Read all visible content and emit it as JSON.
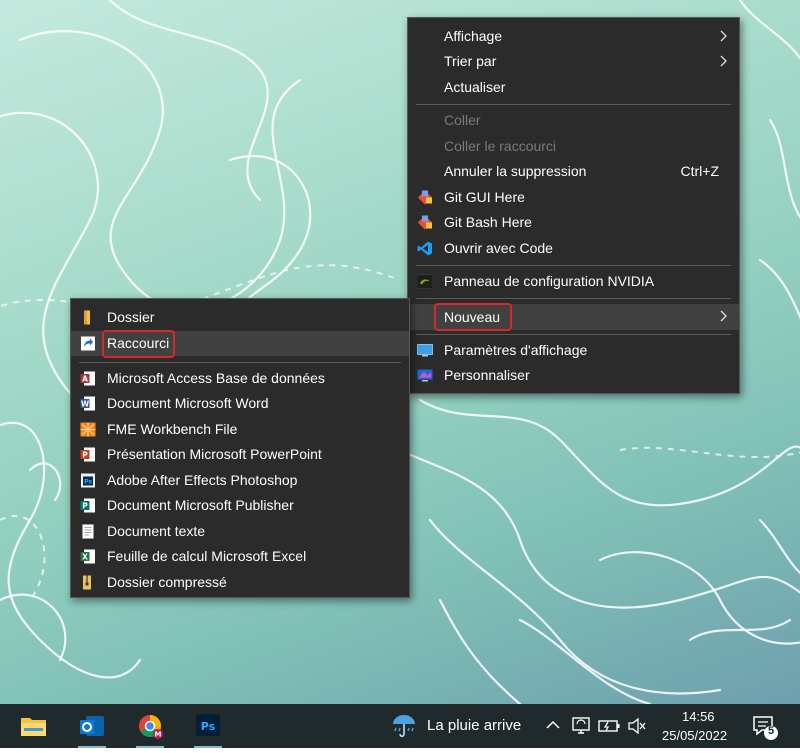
{
  "desktop_menu": {
    "items": [
      {
        "label": "Affichage",
        "submenu": true
      },
      {
        "label": "Trier par",
        "submenu": true
      },
      {
        "label": "Actualiser"
      },
      {
        "label": "Coller",
        "disabled": true
      },
      {
        "label": "Coller le raccourci",
        "disabled": true
      },
      {
        "label": "Annuler la suppression",
        "shortcut": "Ctrl+Z"
      },
      {
        "label": "Git GUI Here",
        "icon": "git-gui-icon"
      },
      {
        "label": "Git Bash Here",
        "icon": "git-bash-icon"
      },
      {
        "label": "Ouvrir avec Code",
        "icon": "vscode-icon"
      },
      {
        "label": "Panneau de configuration NVIDIA",
        "icon": "nvidia-icon"
      },
      {
        "label": "Nouveau",
        "submenu": true,
        "highlighted": true
      },
      {
        "label": "Paramètres d'affichage",
        "icon": "display-settings-icon"
      },
      {
        "label": "Personnaliser",
        "icon": "personalize-icon"
      }
    ]
  },
  "new_submenu": {
    "items": [
      {
        "label": "Dossier",
        "icon": "folder-icon"
      },
      {
        "label": "Raccourci",
        "icon": "shortcut-icon",
        "highlighted": true
      },
      {
        "label": "Microsoft Access Base de données",
        "icon": "access-icon"
      },
      {
        "label": "Document Microsoft Word",
        "icon": "word-icon"
      },
      {
        "label": "FME Workbench File",
        "icon": "fme-icon"
      },
      {
        "label": "Présentation Microsoft PowerPoint",
        "icon": "powerpoint-icon"
      },
      {
        "label": "Adobe After Effects Photoshop",
        "icon": "photoshop-file-icon"
      },
      {
        "label": "Document Microsoft Publisher",
        "icon": "publisher-icon"
      },
      {
        "label": "Document texte",
        "icon": "text-document-icon"
      },
      {
        "label": "Feuille de calcul Microsoft Excel",
        "icon": "excel-icon"
      },
      {
        "label": "Dossier compressé",
        "icon": "zip-folder-icon"
      }
    ]
  },
  "taskbar": {
    "apps": [
      "file-explorer-icon",
      "outlook-icon",
      "chrome-icon",
      "photoshop-icon"
    ],
    "weather": "La pluie arrive",
    "time": "14:56",
    "date": "25/05/2022",
    "notifications": "5"
  },
  "colors": {
    "menu_bg": "#2b2b2b",
    "hover": "#414141",
    "highlight_box": "#d62a2a",
    "taskbar": "#202a2c"
  }
}
